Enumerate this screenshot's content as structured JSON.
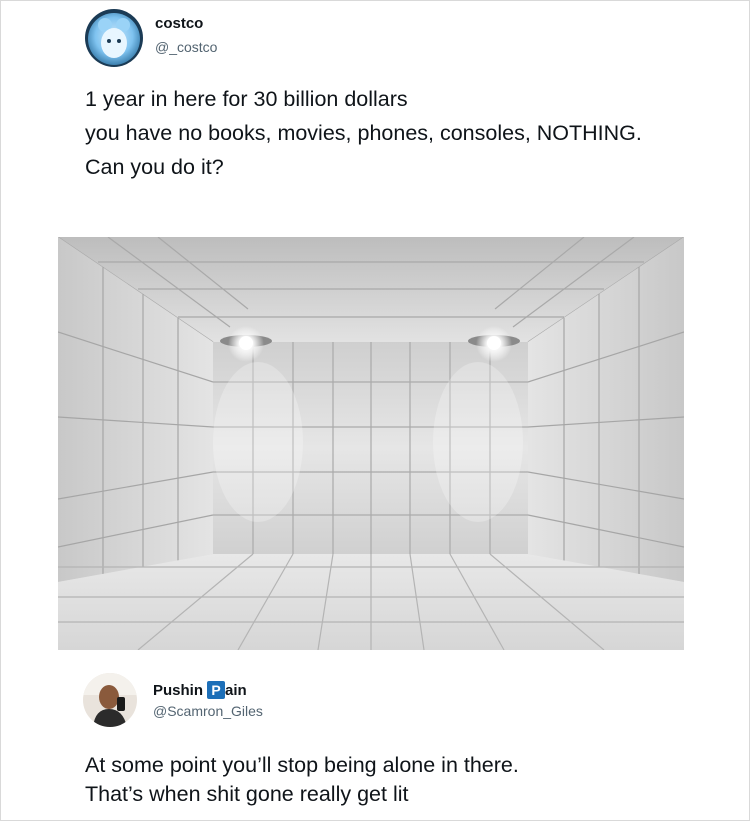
{
  "tweet": {
    "display_name": "costco",
    "handle": "@_costco",
    "lines": [
      "1 year in here for 30 billion dollars",
      "you have no books, movies, phones, consoles, NOTHING.",
      "Can you do it?"
    ],
    "media_description": "padded-room-photo"
  },
  "reply": {
    "display_name_prefix": "Pushin",
    "badge_letter": "P",
    "display_name_suffix": "ain",
    "handle": "@Scamron_Giles",
    "text_lines": [
      "At some point you’ll stop being alone in there.",
      "That’s when shit gone really get lit"
    ]
  },
  "colors": {
    "text": "#0f1419",
    "handle": "#536471",
    "badge": "#1d6fb8",
    "avatar_blue": "#7fc3f0"
  }
}
